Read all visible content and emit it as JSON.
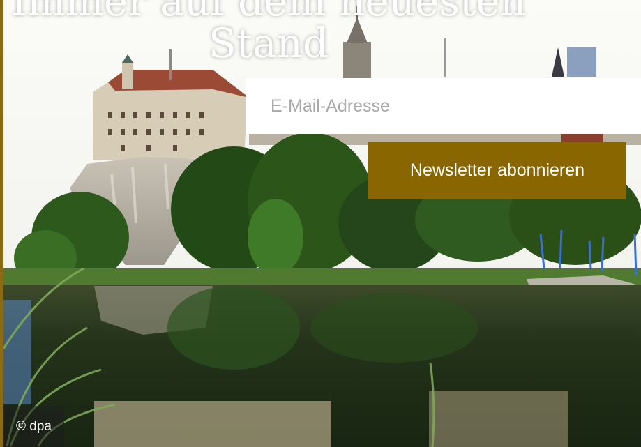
{
  "headline": {
    "line1": "Immer auf dem neuesten",
    "line2": "Stand"
  },
  "newsletter": {
    "email_placeholder": "E-Mail-Adresse",
    "subscribe_label": "Newsletter abonnieren",
    "accent_color": "#8a6600"
  },
  "photo": {
    "credit": "© dpa"
  }
}
